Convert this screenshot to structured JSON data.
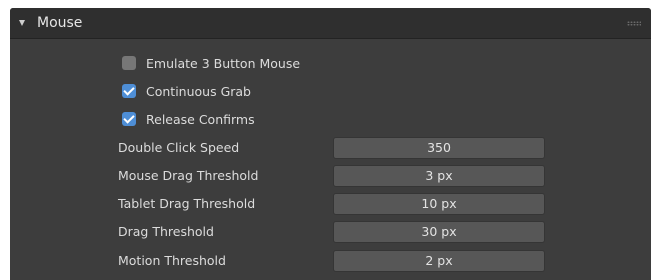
{
  "panel": {
    "title": "Mouse"
  },
  "checkboxes": [
    {
      "label": "Emulate 3 Button Mouse",
      "checked": false
    },
    {
      "label": "Continuous Grab",
      "checked": true
    },
    {
      "label": "Release Confirms",
      "checked": true
    }
  ],
  "properties": [
    {
      "label": "Double Click Speed",
      "value": "350"
    },
    {
      "label": "Mouse Drag Threshold",
      "value": "3 px"
    },
    {
      "label": "Tablet Drag Threshold",
      "value": "10 px"
    },
    {
      "label": "Drag Threshold",
      "value": "30 px"
    },
    {
      "label": "Motion Threshold",
      "value": "2 px"
    }
  ],
  "colors": {
    "panel_bg": "#3d3d3d",
    "header_bg": "#2f2f2f",
    "checkbox_on": "#4e8ed6",
    "checkbox_off": "#777777",
    "field_bg": "#575757"
  }
}
